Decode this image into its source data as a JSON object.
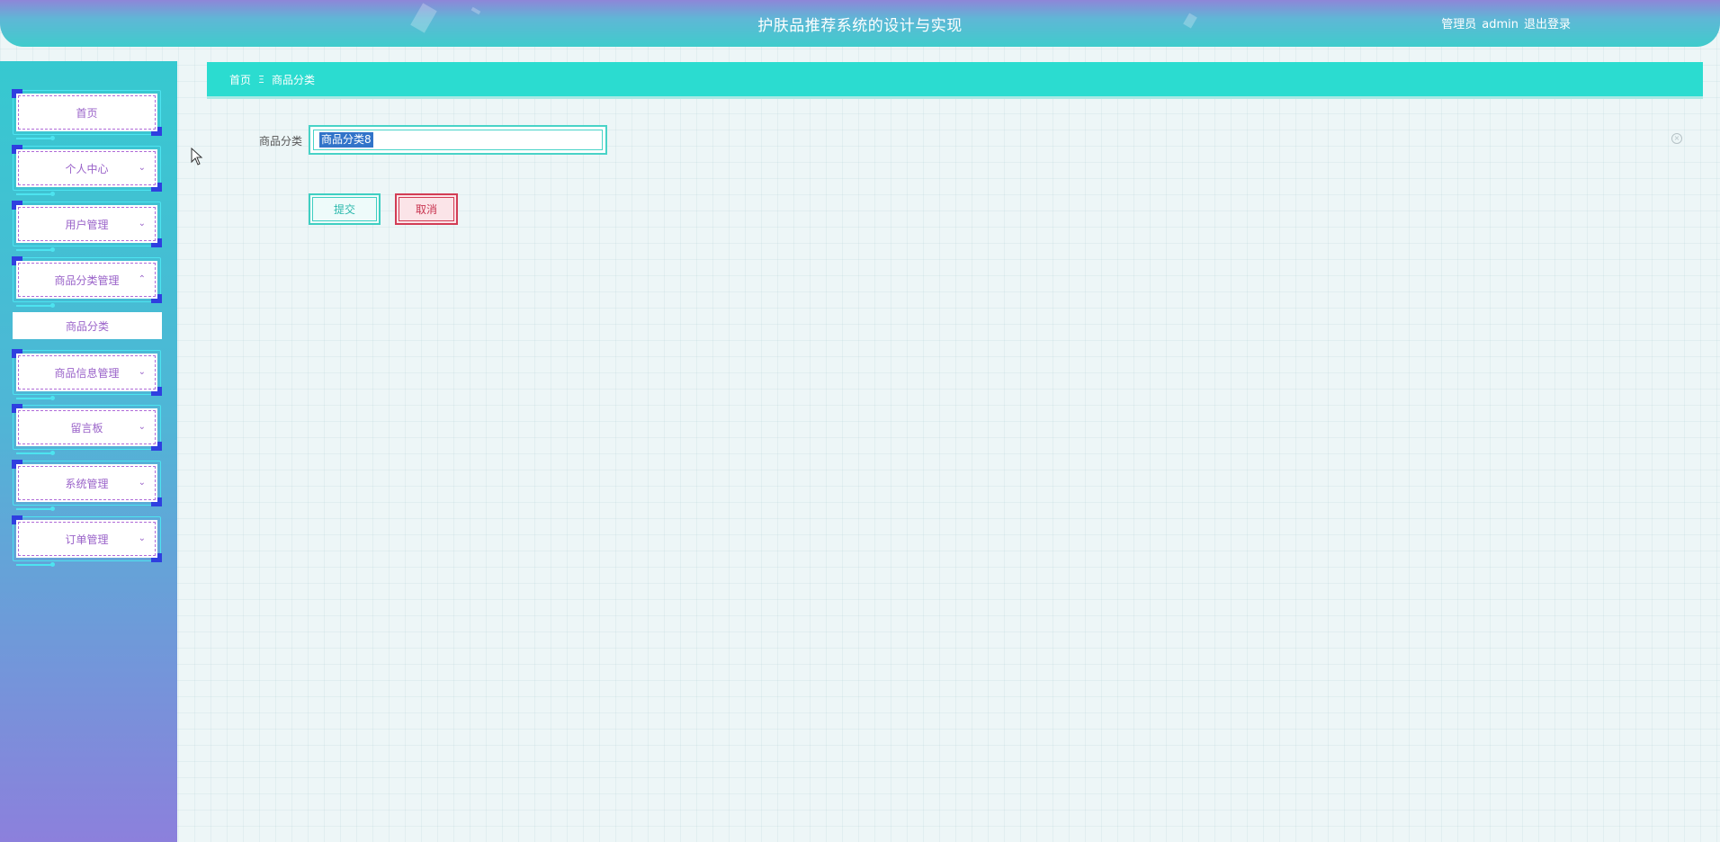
{
  "header": {
    "title": "护肤品推荐系统的设计与实现",
    "role": "管理员",
    "username": "admin",
    "logout": "退出登录"
  },
  "sidebar": {
    "items": [
      {
        "label": "首页",
        "expanded": false,
        "chevron": ""
      },
      {
        "label": "个人中心",
        "expanded": false,
        "chevron": "⌄"
      },
      {
        "label": "用户管理",
        "expanded": false,
        "chevron": "⌄"
      },
      {
        "label": "商品分类管理",
        "expanded": true,
        "chevron": "⌃"
      },
      {
        "label": "商品信息管理",
        "expanded": false,
        "chevron": "⌄"
      },
      {
        "label": "留言板",
        "expanded": false,
        "chevron": "⌄"
      },
      {
        "label": "系统管理",
        "expanded": false,
        "chevron": "⌄"
      },
      {
        "label": "订单管理",
        "expanded": false,
        "chevron": "⌄"
      }
    ],
    "submenu": {
      "label": "商品分类"
    }
  },
  "breadcrumb": {
    "home": "首页",
    "separator": "Ξ",
    "current": "商品分类"
  },
  "form": {
    "field_label": "商品分类",
    "field_value": "商品分类8",
    "submit_label": "提交",
    "cancel_label": "取消"
  },
  "colors": {
    "accent": "#2bdcd0",
    "sidebar_top": "#36c9d0",
    "sidebar_bottom": "#8c80dc",
    "menu_text": "#9a63c9",
    "cancel": "#d23d55"
  }
}
